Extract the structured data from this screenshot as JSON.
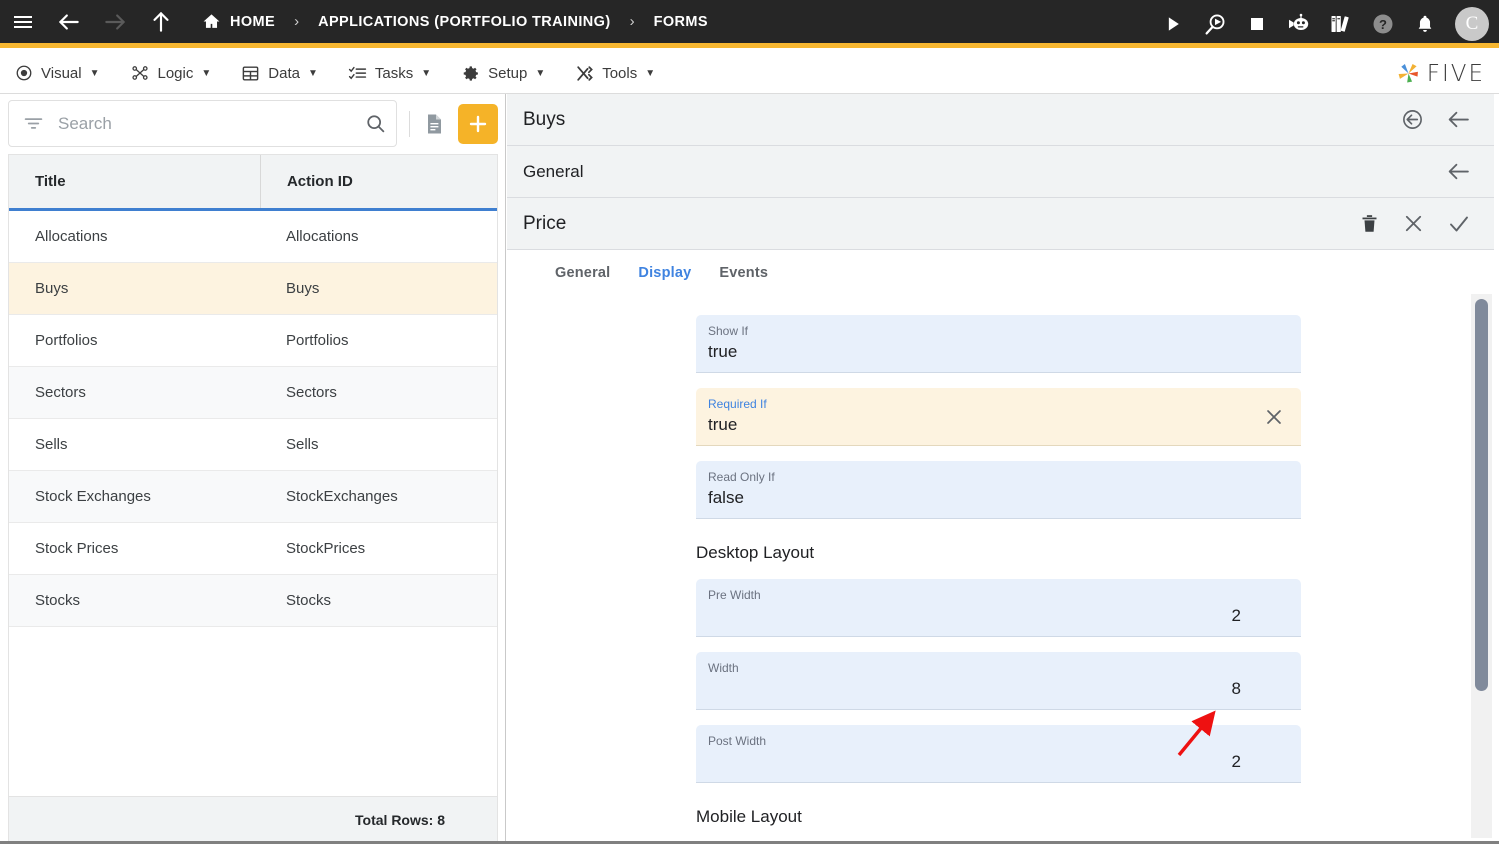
{
  "topbar": {
    "nav_icons": [
      {
        "name": "hamburger-menu-icon",
        "label": "Menu"
      },
      {
        "name": "back-arrow-icon",
        "label": "Back"
      },
      {
        "name": "forward-arrow-icon",
        "label": "Forward"
      },
      {
        "name": "up-arrow-icon",
        "label": "Up"
      }
    ],
    "breadcrumbs": [
      {
        "label": "HOME",
        "icon": "home-icon"
      },
      {
        "label": "APPLICATIONS (PORTFOLIO TRAINING)",
        "icon": ""
      },
      {
        "label": "FORMS",
        "icon": ""
      }
    ],
    "separator": "›",
    "right_icons": [
      {
        "name": "play-icon",
        "label": "Run"
      },
      {
        "name": "search-play-icon",
        "label": "Debug"
      },
      {
        "name": "stop-icon",
        "label": "Stop"
      },
      {
        "name": "robot-icon",
        "label": "Assistant"
      },
      {
        "name": "books-icon",
        "label": "Documentation"
      },
      {
        "name": "help-icon",
        "label": "Help"
      },
      {
        "name": "bell-icon",
        "label": "Notifications"
      }
    ],
    "avatar_initial": "C",
    "accent_color": "#f7b731",
    "background_color": "#262626"
  },
  "menubar": {
    "items": [
      {
        "label": "Visual",
        "icon": "eye-icon",
        "caret": "▼"
      },
      {
        "label": "Logic",
        "icon": "logic-nodes-icon",
        "caret": "▼"
      },
      {
        "label": "Data",
        "icon": "table-icon",
        "caret": "▼"
      },
      {
        "label": "Tasks",
        "icon": "checklist-icon",
        "caret": "▼"
      },
      {
        "label": "Setup",
        "icon": "gear-icon",
        "caret": "▼"
      },
      {
        "label": "Tools",
        "icon": "tools-icon",
        "caret": "▼"
      }
    ],
    "brand": "FIVE"
  },
  "sidebar": {
    "search": {
      "placeholder": "Search",
      "value": ""
    },
    "toolbar": {
      "filter_icon": "filter-icon",
      "search_icon": "search-icon",
      "document_icon": "document-icon",
      "add_label": "+"
    },
    "grid": {
      "columns": [
        "Title",
        "Action ID"
      ],
      "rows": [
        {
          "title": "Allocations",
          "action_id": "Allocations",
          "selected": false
        },
        {
          "title": "Buys",
          "action_id": "Buys",
          "selected": true
        },
        {
          "title": "Portfolios",
          "action_id": "Portfolios",
          "selected": false
        },
        {
          "title": "Sectors",
          "action_id": "Sectors",
          "selected": false
        },
        {
          "title": "Sells",
          "action_id": "Sells",
          "selected": false
        },
        {
          "title": "Stock Exchanges",
          "action_id": "StockExchanges",
          "selected": false
        },
        {
          "title": "Stock Prices",
          "action_id": "StockPrices",
          "selected": false
        },
        {
          "title": "Stocks",
          "action_id": "Stocks",
          "selected": false
        }
      ]
    },
    "footer": {
      "total_rows": "Total Rows: 8"
    }
  },
  "main": {
    "form_header": {
      "title": "Buys",
      "icons": [
        "revert-icon",
        "back-arrow-icon"
      ]
    },
    "section_header": {
      "title": "General",
      "icons": [
        "back-arrow-icon"
      ]
    },
    "field_header": {
      "title": "Price",
      "icons": [
        "delete-icon",
        "cancel-icon",
        "confirm-icon"
      ]
    },
    "tabs": [
      {
        "label": "General",
        "active": false
      },
      {
        "label": "Display",
        "active": true
      },
      {
        "label": "Events",
        "active": false
      }
    ],
    "fields": [
      {
        "label": "Show If",
        "value": "true",
        "focused": false,
        "numeric": false,
        "clearable": false
      },
      {
        "label": "Required If",
        "value": "true",
        "focused": true,
        "numeric": false,
        "clearable": true
      },
      {
        "label": "Read Only If",
        "value": "false",
        "focused": false,
        "numeric": false,
        "clearable": false
      }
    ],
    "desktop_layout": {
      "heading": "Desktop Layout",
      "fields": [
        {
          "label": "Pre Width",
          "value": "2",
          "numeric": true
        },
        {
          "label": "Width",
          "value": "8",
          "numeric": true
        },
        {
          "label": "Post Width",
          "value": "2",
          "numeric": true
        }
      ]
    },
    "mobile_layout": {
      "heading": "Mobile Layout"
    },
    "colors": {
      "field_background": "#e8f0fb",
      "focused_field_background": "#fdf3e0",
      "active_tab": "#3f83e0",
      "selected_row": "#fdf3e0"
    }
  },
  "annotation": {
    "type": "arrow",
    "color": "#ee1111",
    "points_to": "Required If"
  }
}
